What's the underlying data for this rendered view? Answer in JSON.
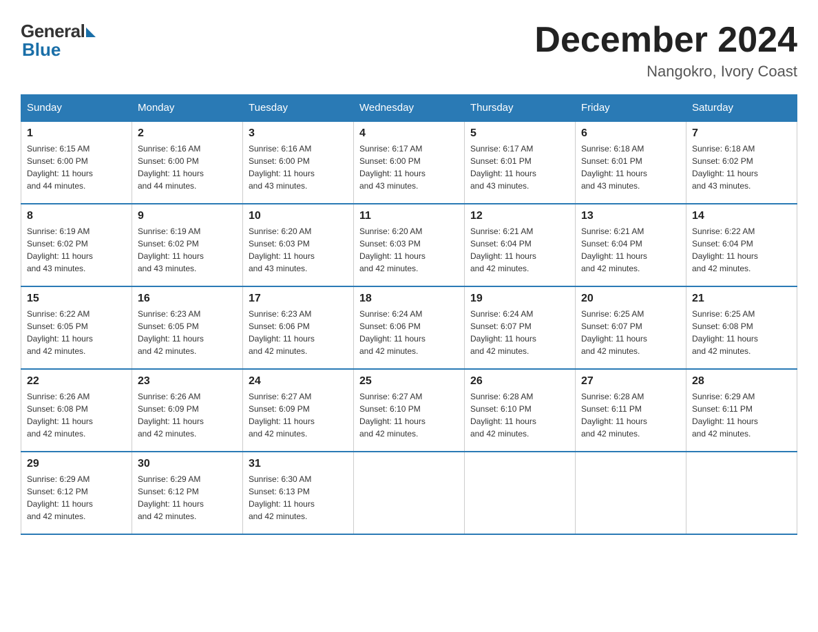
{
  "logo": {
    "general": "General",
    "blue": "Blue"
  },
  "title": {
    "month_year": "December 2024",
    "location": "Nangokro, Ivory Coast"
  },
  "days_of_week": [
    "Sunday",
    "Monday",
    "Tuesday",
    "Wednesday",
    "Thursday",
    "Friday",
    "Saturday"
  ],
  "weeks": [
    [
      {
        "day": "1",
        "sunrise": "6:15 AM",
        "sunset": "6:00 PM",
        "daylight": "11 hours and 44 minutes."
      },
      {
        "day": "2",
        "sunrise": "6:16 AM",
        "sunset": "6:00 PM",
        "daylight": "11 hours and 44 minutes."
      },
      {
        "day": "3",
        "sunrise": "6:16 AM",
        "sunset": "6:00 PM",
        "daylight": "11 hours and 43 minutes."
      },
      {
        "day": "4",
        "sunrise": "6:17 AM",
        "sunset": "6:00 PM",
        "daylight": "11 hours and 43 minutes."
      },
      {
        "day": "5",
        "sunrise": "6:17 AM",
        "sunset": "6:01 PM",
        "daylight": "11 hours and 43 minutes."
      },
      {
        "day": "6",
        "sunrise": "6:18 AM",
        "sunset": "6:01 PM",
        "daylight": "11 hours and 43 minutes."
      },
      {
        "day": "7",
        "sunrise": "6:18 AM",
        "sunset": "6:02 PM",
        "daylight": "11 hours and 43 minutes."
      }
    ],
    [
      {
        "day": "8",
        "sunrise": "6:19 AM",
        "sunset": "6:02 PM",
        "daylight": "11 hours and 43 minutes."
      },
      {
        "day": "9",
        "sunrise": "6:19 AM",
        "sunset": "6:02 PM",
        "daylight": "11 hours and 43 minutes."
      },
      {
        "day": "10",
        "sunrise": "6:20 AM",
        "sunset": "6:03 PM",
        "daylight": "11 hours and 43 minutes."
      },
      {
        "day": "11",
        "sunrise": "6:20 AM",
        "sunset": "6:03 PM",
        "daylight": "11 hours and 42 minutes."
      },
      {
        "day": "12",
        "sunrise": "6:21 AM",
        "sunset": "6:04 PM",
        "daylight": "11 hours and 42 minutes."
      },
      {
        "day": "13",
        "sunrise": "6:21 AM",
        "sunset": "6:04 PM",
        "daylight": "11 hours and 42 minutes."
      },
      {
        "day": "14",
        "sunrise": "6:22 AM",
        "sunset": "6:04 PM",
        "daylight": "11 hours and 42 minutes."
      }
    ],
    [
      {
        "day": "15",
        "sunrise": "6:22 AM",
        "sunset": "6:05 PM",
        "daylight": "11 hours and 42 minutes."
      },
      {
        "day": "16",
        "sunrise": "6:23 AM",
        "sunset": "6:05 PM",
        "daylight": "11 hours and 42 minutes."
      },
      {
        "day": "17",
        "sunrise": "6:23 AM",
        "sunset": "6:06 PM",
        "daylight": "11 hours and 42 minutes."
      },
      {
        "day": "18",
        "sunrise": "6:24 AM",
        "sunset": "6:06 PM",
        "daylight": "11 hours and 42 minutes."
      },
      {
        "day": "19",
        "sunrise": "6:24 AM",
        "sunset": "6:07 PM",
        "daylight": "11 hours and 42 minutes."
      },
      {
        "day": "20",
        "sunrise": "6:25 AM",
        "sunset": "6:07 PM",
        "daylight": "11 hours and 42 minutes."
      },
      {
        "day": "21",
        "sunrise": "6:25 AM",
        "sunset": "6:08 PM",
        "daylight": "11 hours and 42 minutes."
      }
    ],
    [
      {
        "day": "22",
        "sunrise": "6:26 AM",
        "sunset": "6:08 PM",
        "daylight": "11 hours and 42 minutes."
      },
      {
        "day": "23",
        "sunrise": "6:26 AM",
        "sunset": "6:09 PM",
        "daylight": "11 hours and 42 minutes."
      },
      {
        "day": "24",
        "sunrise": "6:27 AM",
        "sunset": "6:09 PM",
        "daylight": "11 hours and 42 minutes."
      },
      {
        "day": "25",
        "sunrise": "6:27 AM",
        "sunset": "6:10 PM",
        "daylight": "11 hours and 42 minutes."
      },
      {
        "day": "26",
        "sunrise": "6:28 AM",
        "sunset": "6:10 PM",
        "daylight": "11 hours and 42 minutes."
      },
      {
        "day": "27",
        "sunrise": "6:28 AM",
        "sunset": "6:11 PM",
        "daylight": "11 hours and 42 minutes."
      },
      {
        "day": "28",
        "sunrise": "6:29 AM",
        "sunset": "6:11 PM",
        "daylight": "11 hours and 42 minutes."
      }
    ],
    [
      {
        "day": "29",
        "sunrise": "6:29 AM",
        "sunset": "6:12 PM",
        "daylight": "11 hours and 42 minutes."
      },
      {
        "day": "30",
        "sunrise": "6:29 AM",
        "sunset": "6:12 PM",
        "daylight": "11 hours and 42 minutes."
      },
      {
        "day": "31",
        "sunrise": "6:30 AM",
        "sunset": "6:13 PM",
        "daylight": "11 hours and 42 minutes."
      },
      null,
      null,
      null,
      null
    ]
  ],
  "labels": {
    "sunrise": "Sunrise:",
    "sunset": "Sunset:",
    "daylight": "Daylight:"
  }
}
